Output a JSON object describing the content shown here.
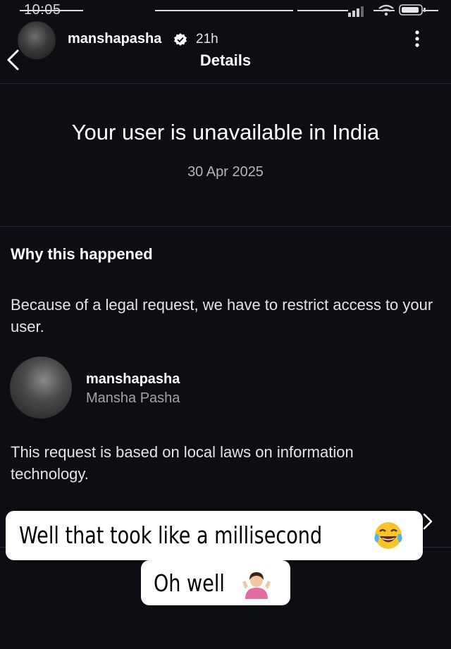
{
  "status_bar": {
    "time": "10:05"
  },
  "story": {
    "username": "manshapasha",
    "time_ago": "21h"
  },
  "header": {
    "title": "Details"
  },
  "main": {
    "heading": "Your user is unavailable in India",
    "date": "30 Apr 2025"
  },
  "why": {
    "title": "Why this happened",
    "description": "Because of a legal request, we have to restrict access to your user.",
    "profile": {
      "username": "manshapasha",
      "name": "Mansha Pasha"
    },
    "note": "This request is based on local laws on information technology."
  },
  "stickers": {
    "line1": "Well that took like a millisecond",
    "line2": "Oh well"
  },
  "icons": {
    "back": "chevron-left-icon",
    "more": "more-vertical-icon",
    "verified": "verified-badge-icon",
    "laugh": "face-with-tears-of-joy-emoji",
    "shrug": "person-shrugging-emoji",
    "row_arrow": "chevron-right-icon"
  },
  "colors": {
    "background": "#0d0e14",
    "text": "#ffffff",
    "secondary_text": "#a3a3a3",
    "sticker": "#ffffff"
  }
}
